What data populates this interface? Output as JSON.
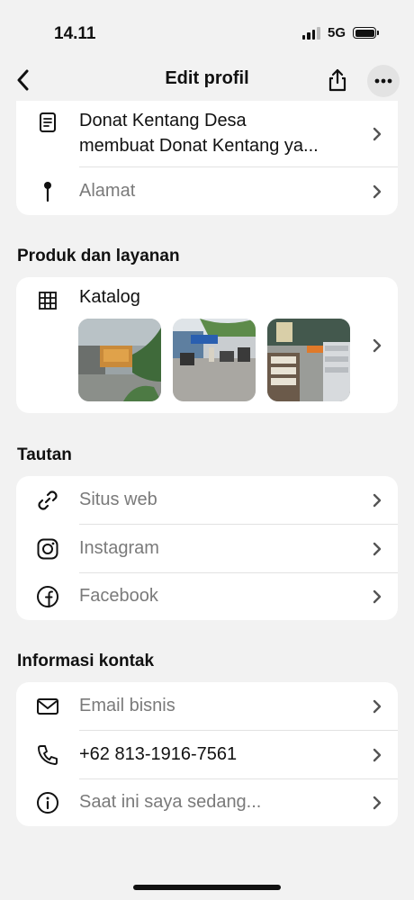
{
  "status_bar": {
    "time": "14.11",
    "network": "5G"
  },
  "nav": {
    "title": "Edit profil"
  },
  "about": {
    "line1": "Donat Kentang Desa",
    "line2": "membuat Donat Kentang ya...",
    "address_label": "Alamat"
  },
  "products": {
    "section_title": "Produk dan layanan",
    "catalog_label": "Katalog"
  },
  "links": {
    "section_title": "Tautan",
    "items": [
      {
        "label": "Situs web",
        "icon": "link-icon"
      },
      {
        "label": "Instagram",
        "icon": "instagram-icon"
      },
      {
        "label": "Facebook",
        "icon": "facebook-icon"
      }
    ]
  },
  "contact": {
    "section_title": "Informasi kontak",
    "items": [
      {
        "label": "Email bisnis",
        "icon": "mail-icon"
      },
      {
        "label": "+62 813-1916-7561",
        "icon": "phone-icon"
      },
      {
        "label": "Saat ini saya sedang...",
        "icon": "info-icon"
      }
    ]
  },
  "colors": {
    "background": "#f2f2f2",
    "card": "#ffffff",
    "muted_text": "#7a7a7a"
  }
}
